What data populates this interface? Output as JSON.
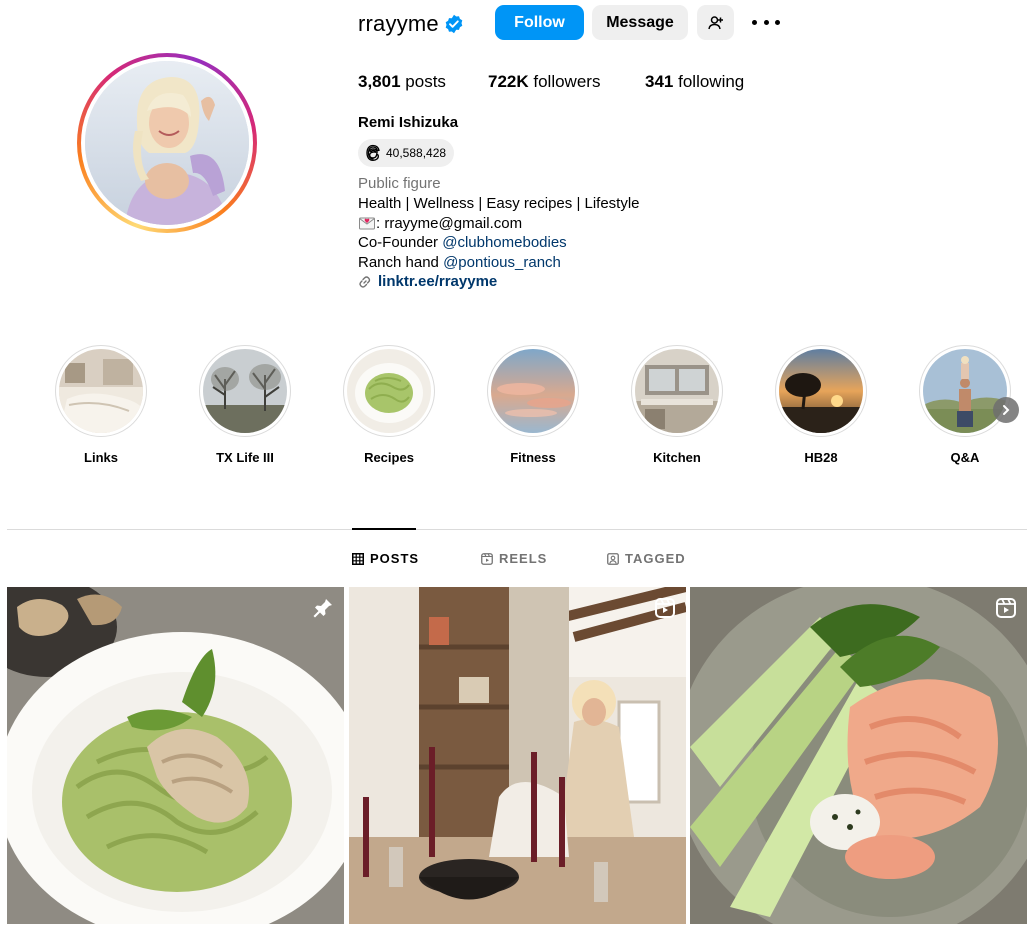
{
  "profile": {
    "username": "rrayyme",
    "follow_label": "Follow",
    "message_label": "Message",
    "stats": {
      "posts_count": "3,801",
      "posts_label": "posts",
      "followers_count": "722K",
      "followers_label": "followers",
      "following_count": "341",
      "following_label": "following"
    },
    "full_name": "Remi Ishizuka",
    "threads_count": "40,588,428",
    "category": "Public figure",
    "bio": {
      "line1": "Health | Wellness | Easy recipes | Lifestyle",
      "email_line": ": rrayyme@gmail.com",
      "cofounder_prefix": "Co-Founder ",
      "cofounder_mention": "@clubhomebodies",
      "ranch_prefix": "Ranch hand ",
      "ranch_mention": "@pontious_ranch",
      "link": "linktr.ee/rrayyme"
    }
  },
  "highlights": [
    {
      "label": "Links"
    },
    {
      "label": "TX Life III"
    },
    {
      "label": "Recipes"
    },
    {
      "label": "Fitness"
    },
    {
      "label": "Kitchen"
    },
    {
      "label": "HB28"
    },
    {
      "label": "Q&A"
    }
  ],
  "tabs": {
    "posts": "POSTS",
    "reels": "REELS",
    "tagged": "TAGGED"
  },
  "colors": {
    "accent": "#0095f6",
    "link": "#00376b",
    "muted": "#737373",
    "button_bg": "#efefef"
  },
  "icons": {
    "verified": "verified-badge-icon",
    "threads": "threads-icon",
    "link": "link-icon",
    "pinned": "pin-icon",
    "reel": "reel-icon"
  }
}
